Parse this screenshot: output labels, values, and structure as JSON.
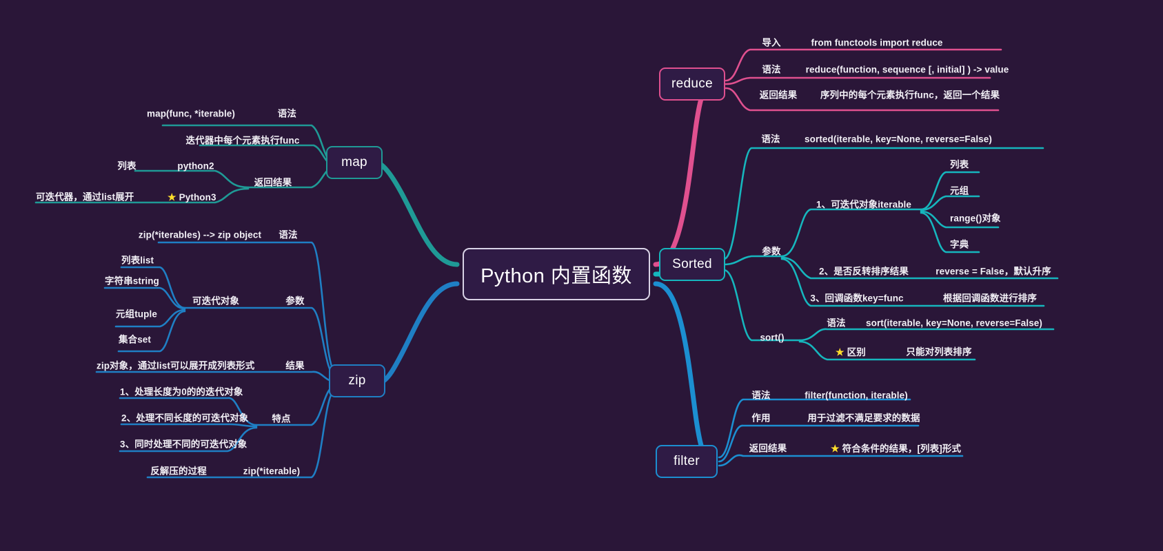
{
  "meta": {
    "background": "#2a1638",
    "root_border": "#d9d3e6",
    "colors": {
      "map": "#1f9a96",
      "zip": "#1f7fc4",
      "reduce": "#e0508f",
      "sorted": "#16b6bd",
      "filter": "#1c8fd1",
      "star": "#ffdf2b"
    }
  },
  "root": {
    "label": "Python 内置函数"
  },
  "branches": {
    "map": {
      "label": "map",
      "color": "#1f9a96",
      "items": [
        {
          "key": "语法",
          "value": "map(func, *iterable)"
        },
        {
          "key": "",
          "value": "迭代器中每个元素执行func"
        },
        {
          "key": "返回结果",
          "value": "",
          "children": [
            {
              "key": "python2",
              "value": "列表"
            },
            {
              "key": "Python3",
              "value": "可迭代器，通过list展开",
              "star": true
            }
          ]
        }
      ]
    },
    "zip": {
      "label": "zip",
      "color": "#1f7fc4",
      "items": [
        {
          "key": "语法",
          "value": "zip(*iterables) --> zip object"
        },
        {
          "key": "参数",
          "value": "可迭代对象",
          "children": [
            {
              "value": "列表list"
            },
            {
              "value": "字符串string"
            },
            {
              "value": "元组tuple"
            },
            {
              "value": "集合set"
            }
          ]
        },
        {
          "key": "结果",
          "value": "zip对象，通过list可以展开成列表形式"
        },
        {
          "key": "特点",
          "value": "",
          "children": [
            {
              "value": "1、处理长度为0的的迭代对象"
            },
            {
              "value": "2、处理不同长度的可迭代对象"
            },
            {
              "value": "3、同时处理不同的可迭代对象"
            }
          ]
        },
        {
          "key": "zip(*iterable)",
          "value": "反解压的过程"
        }
      ]
    },
    "reduce": {
      "label": "reduce",
      "color": "#e0508f",
      "items": [
        {
          "key": "导入",
          "value": "from functools import reduce"
        },
        {
          "key": "语法",
          "value": "reduce(function, sequence [, initial] ) -> value"
        },
        {
          "key": "返回结果",
          "value": "序列中的每个元素执行func，返回一个结果"
        }
      ]
    },
    "sorted": {
      "label": "Sorted",
      "color": "#16b6bd",
      "items": [
        {
          "key": "语法",
          "value": "sorted(iterable, key=None, reverse=False)"
        },
        {
          "key": "参数",
          "value": "",
          "children": [
            {
              "key": "1、可迭代对象iterable",
              "value": "",
              "leaves": [
                {
                  "value": "列表"
                },
                {
                  "value": "元组"
                },
                {
                  "value": "range()对象"
                },
                {
                  "value": "字典"
                }
              ]
            },
            {
              "key": "2、是否反转排序结果",
              "value": "reverse = False，默认升序"
            },
            {
              "key": "3、回调函数key=func",
              "value": "根据回调函数进行排序"
            }
          ]
        },
        {
          "key": "sort()",
          "value": "",
          "children": [
            {
              "key": "语法",
              "value": "sort(iterable, key=None, reverse=False)"
            },
            {
              "key": "区别",
              "value": "只能对列表排序",
              "star": true
            }
          ]
        }
      ]
    },
    "filter": {
      "label": "filter",
      "color": "#1c8fd1",
      "items": [
        {
          "key": "语法",
          "value": "filter(function, iterable)"
        },
        {
          "key": "作用",
          "value": "用于过滤不满足要求的数据"
        },
        {
          "key": "返回结果",
          "value": "符合条件的结果，[列表]形式",
          "star": true
        }
      ]
    }
  },
  "labels": {
    "map_syntax_key": "语法",
    "map_syntax_value": "map(func, *iterable)",
    "map_exec": "迭代器中每个元素执行func",
    "map_return_key": "返回结果",
    "map_py2": "python2",
    "map_py2_val": "列表",
    "map_py3": "Python3",
    "map_py3_val": "可迭代器，通过list展开",
    "zip_syntax_key": "语法",
    "zip_syntax_value": "zip(*iterables) --> zip object",
    "zip_param_key": "参数",
    "zip_param_value": "可迭代对象",
    "zip_list": "列表list",
    "zip_string": "字符串string",
    "zip_tuple": "元组tuple",
    "zip_set": "集合set",
    "zip_result_key": "结果",
    "zip_result_value": "zip对象，通过list可以展开成列表形式",
    "zip_feature_key": "特点",
    "zip_f1": "1、处理长度为0的的迭代对象",
    "zip_f2": "2、处理不同长度的可迭代对象",
    "zip_f3": "3、同时处理不同的可迭代对象",
    "zip_unzip_key": "zip(*iterable)",
    "zip_unzip_value": "反解压的过程",
    "reduce_import_key": "导入",
    "reduce_import_value": "from functools import reduce",
    "reduce_syntax_key": "语法",
    "reduce_syntax_value": "reduce(function, sequence [, initial] ) -> value",
    "reduce_return_key": "返回结果",
    "reduce_return_value": "序列中的每个元素执行func，返回一个结果",
    "sorted_syntax_key": "语法",
    "sorted_syntax_value": "sorted(iterable, key=None, reverse=False)",
    "sorted_param_key": "参数",
    "sorted_p1": "1、可迭代对象iterable",
    "sorted_p1_a": "列表",
    "sorted_p1_b": "元组",
    "sorted_p1_c": "range()对象",
    "sorted_p1_d": "字典",
    "sorted_p2": "2、是否反转排序结果",
    "sorted_p2_val": "reverse = False，默认升序",
    "sorted_p3": "3、回调函数key=func",
    "sorted_p3_val": "根据回调函数进行排序",
    "sorted_sort_key": "sort()",
    "sorted_sort_syntax_key": "语法",
    "sorted_sort_syntax_value": "sort(iterable, key=None, reverse=False)",
    "sorted_diff_key": "区别",
    "sorted_diff_value": "只能对列表排序",
    "filter_syntax_key": "语法",
    "filter_syntax_value": "filter(function, iterable)",
    "filter_use_key": "作用",
    "filter_use_value": "用于过滤不满足要求的数据",
    "filter_return_key": "返回结果",
    "filter_return_value": "符合条件的结果，[列表]形式"
  }
}
